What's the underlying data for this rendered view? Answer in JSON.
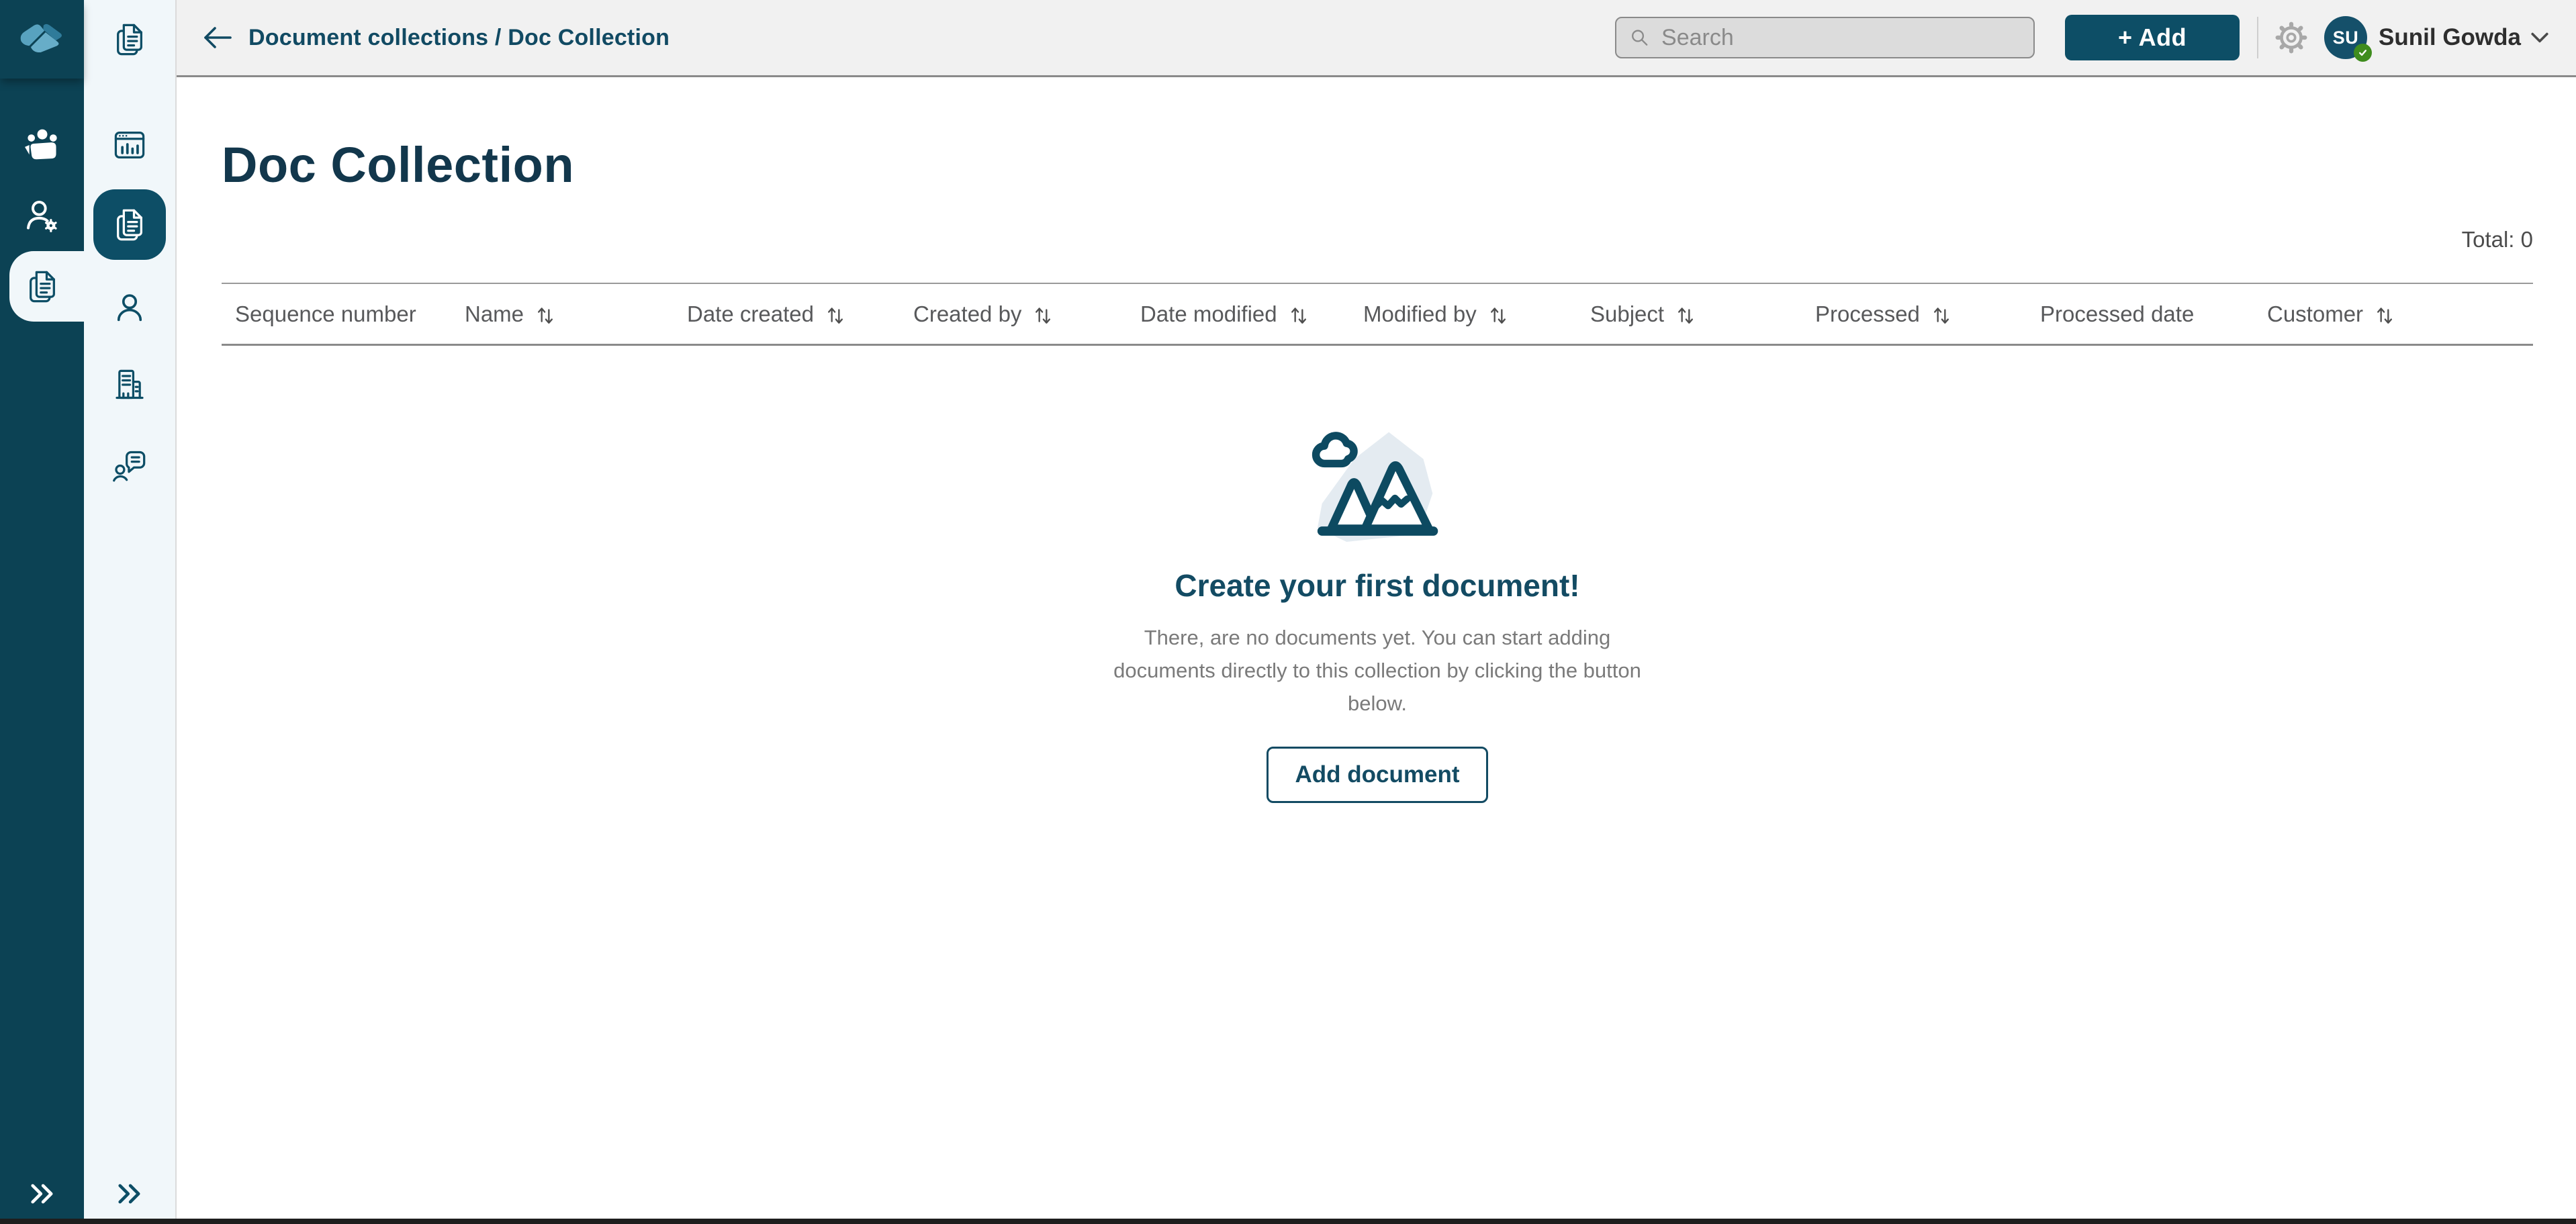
{
  "colors": {
    "sidebar_dark": "#0c4254",
    "accent_teal": "#0d4e66",
    "topbar_bg": "#f1f1f1",
    "secondary_sidebar_bg": "#f1f7fa",
    "heading_text": "#12374c",
    "muted_text": "#7a7a7a",
    "avatar_bg": "#15506a",
    "status_green": "#3f8c1e"
  },
  "topbar": {
    "breadcrumb": "Document collections / Doc Collection",
    "search_placeholder": "Search",
    "add_button_label": "+ Add",
    "user": {
      "initials": "SU",
      "name": "Sunil Gowda"
    }
  },
  "page": {
    "title": "Doc Collection",
    "total_label": "Total: 0"
  },
  "table": {
    "columns": [
      {
        "label": "Sequence number",
        "sortable": false
      },
      {
        "label": "Name",
        "sortable": true
      },
      {
        "label": "Date created",
        "sortable": true
      },
      {
        "label": "Created by",
        "sortable": true
      },
      {
        "label": "Date modified",
        "sortable": true
      },
      {
        "label": "Modified by",
        "sortable": true
      },
      {
        "label": "Subject",
        "sortable": true
      },
      {
        "label": "Processed",
        "sortable": true
      },
      {
        "label": "Processed date",
        "sortable": false
      },
      {
        "label": "Customer",
        "sortable": true
      }
    ]
  },
  "empty_state": {
    "heading": "Create your first document!",
    "body_lines": [
      "There, are no documents yet. You can start adding",
      "documents directly to this collection by clicking the button",
      "below."
    ],
    "button_label": "Add document"
  }
}
